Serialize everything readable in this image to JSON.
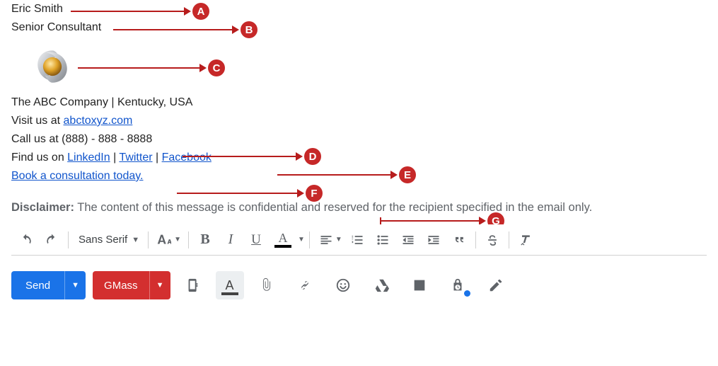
{
  "signature": {
    "name": "Eric Smith",
    "title": "Senior Consultant",
    "company_line": "The ABC Company | Kentucky, USA",
    "visit_prefix": "Visit us at ",
    "website": "abctoxyz.com",
    "call_line": "Call us at (888) - 888 - 8888",
    "find_prefix": "Find us on ",
    "social_sep": " | ",
    "linkedin": "LinkedIn",
    "twitter": "Twitter",
    "facebook": "Facebook",
    "cta": "Book a consultation today."
  },
  "disclaimer": {
    "label": "Disclaimer:",
    "text": " The content of this message is confidential and reserved for the recipient specified in the email only."
  },
  "annotations": {
    "a": "A",
    "b": "B",
    "c": "C",
    "d": "D",
    "e": "E",
    "f": "F",
    "g": "G"
  },
  "toolbar": {
    "font": "Sans Serif"
  },
  "actions": {
    "send": "Send",
    "gmass": "GMass"
  }
}
